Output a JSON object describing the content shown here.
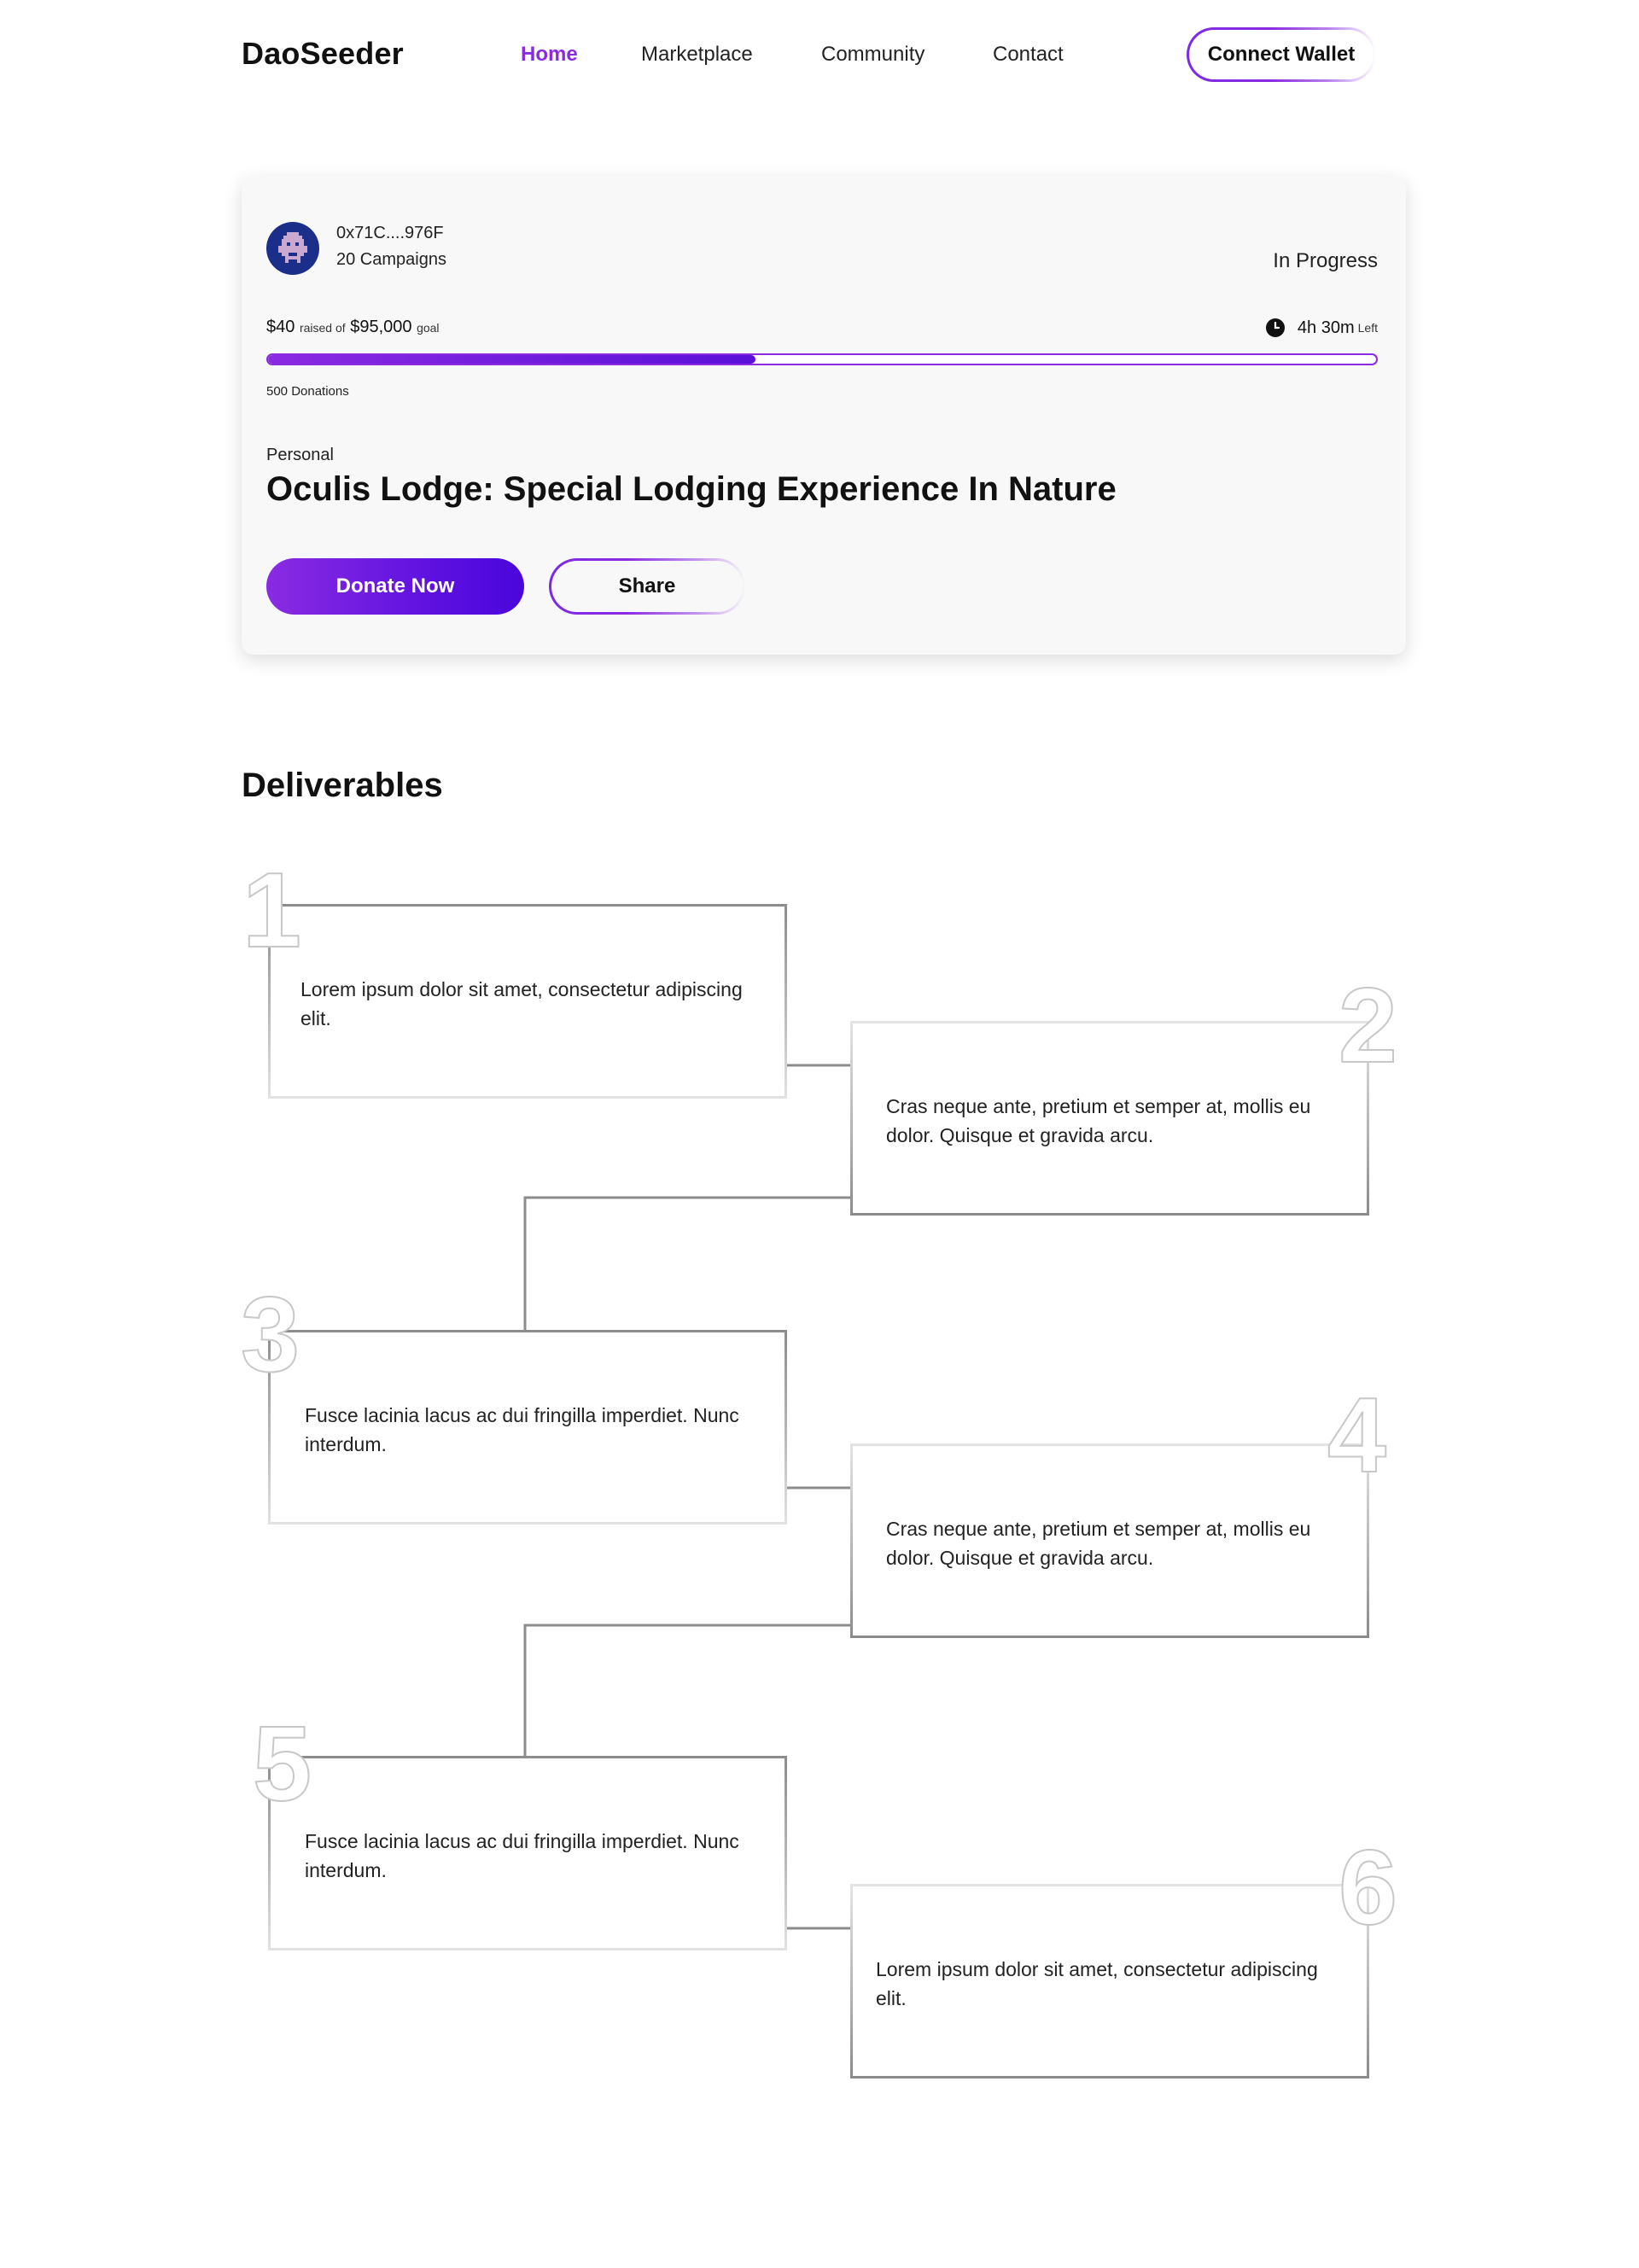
{
  "brand": {
    "name": "DaoSeeder"
  },
  "nav": {
    "items": [
      {
        "label": "Home",
        "active": true
      },
      {
        "label": "Marketplace",
        "active": false
      },
      {
        "label": "Community",
        "active": false
      },
      {
        "label": "Contact",
        "active": false
      }
    ],
    "connect_label": "Connect Wallet"
  },
  "campaign": {
    "creator_address": "0x71C....976F",
    "creator_campaigns": "20 Campaigns",
    "status": "In Progress",
    "raised_amount": "$40",
    "raised_of": "raised of",
    "goal_amount": "$95,000",
    "goal_label": "goal",
    "time_left": "4h 30m",
    "time_left_suffix": "Left",
    "progress_fraction": 0.44,
    "donations": "500 Donations",
    "category": "Personal",
    "title": "Oculis Lodge: Special Lodging Experience In Nature",
    "donate_label": "Donate Now",
    "share_label": "Share"
  },
  "deliverables": {
    "title": "Deliverables",
    "items": [
      {
        "number": "1",
        "text": "Lorem ipsum dolor sit amet, consectetur adipiscing elit."
      },
      {
        "number": "2",
        "text": "Cras neque ante, pretium et semper at, mollis eu dolor. Quisque et gravida arcu."
      },
      {
        "number": "3",
        "text": "Fusce lacinia lacus ac dui fringilla imperdiet. Nunc interdum."
      },
      {
        "number": "4",
        "text": "Cras neque ante, pretium et semper at, mollis eu dolor. Quisque et gravida arcu."
      },
      {
        "number": "5",
        "text": "Fusce lacinia lacus ac dui fringilla imperdiet. Nunc interdum."
      },
      {
        "number": "6",
        "text": "Lorem ipsum dolor sit amet, consectetur adipiscing elit."
      }
    ]
  },
  "colors": {
    "accent": "#8a2be2",
    "accent_dark": "#4a06db",
    "avatar_bg": "#1b2f8a",
    "outline_gray": "#c8c8c8"
  }
}
